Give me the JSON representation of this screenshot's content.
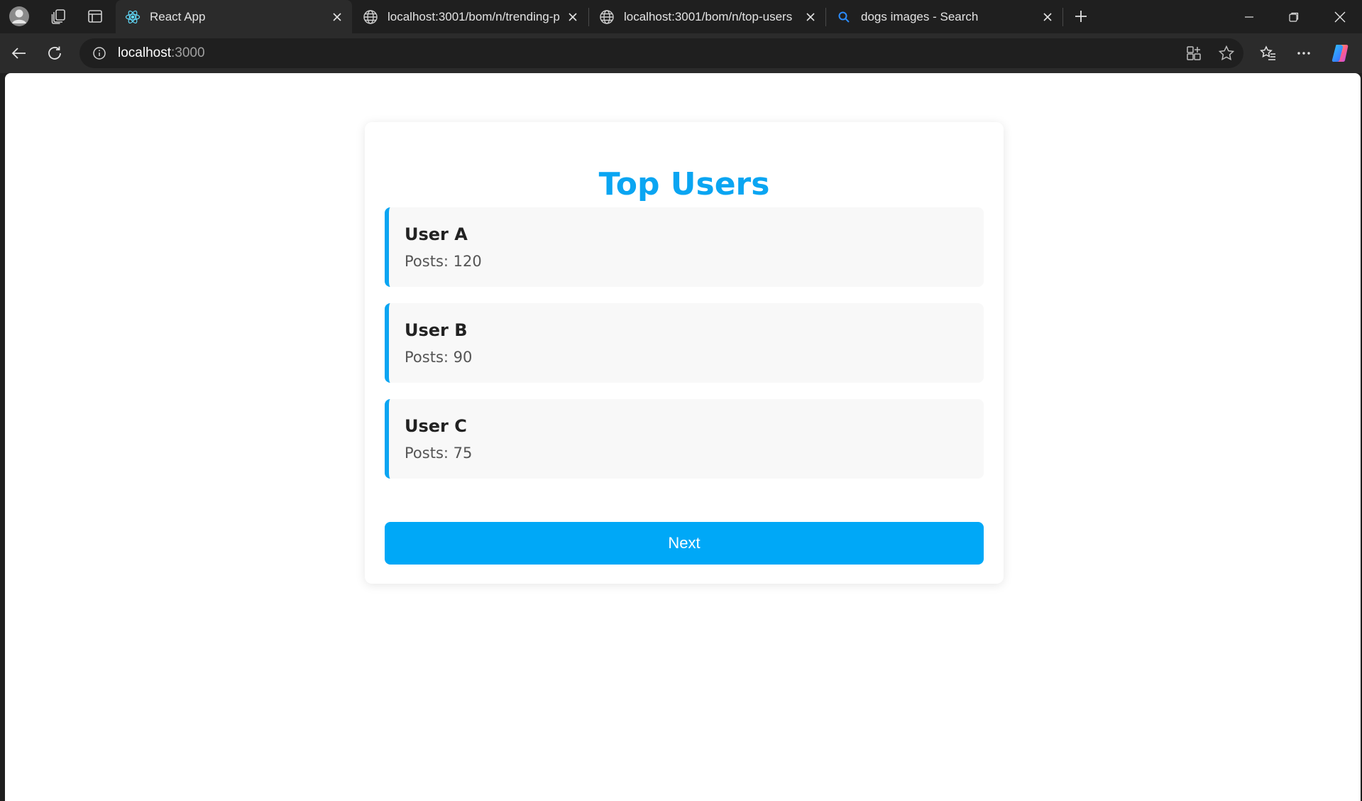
{
  "browser": {
    "tabs": [
      {
        "title": "React App",
        "favicon": "react-icon",
        "active": true
      },
      {
        "title": "localhost:3001/bom/n/trending-p",
        "favicon": "globe-icon",
        "active": false
      },
      {
        "title": "localhost:3001/bom/n/top-users",
        "favicon": "globe-icon",
        "active": false
      },
      {
        "title": "dogs images - Search",
        "favicon": "search-icon",
        "active": false
      }
    ],
    "url_host": "localhost",
    "url_port": ":3000"
  },
  "page": {
    "title": "Top Users",
    "users": [
      {
        "name": "User A",
        "posts": "Posts: 120"
      },
      {
        "name": "User B",
        "posts": "Posts: 90"
      },
      {
        "name": "User C",
        "posts": "Posts: 75"
      }
    ],
    "next_label": "Next"
  },
  "colors": {
    "accent": "#0aa5f2",
    "button": "#00a8f7",
    "card_bg": "#f8f8f8",
    "chrome_dark": "#1f1f1f",
    "chrome_toolbar": "#2b2b2b"
  }
}
